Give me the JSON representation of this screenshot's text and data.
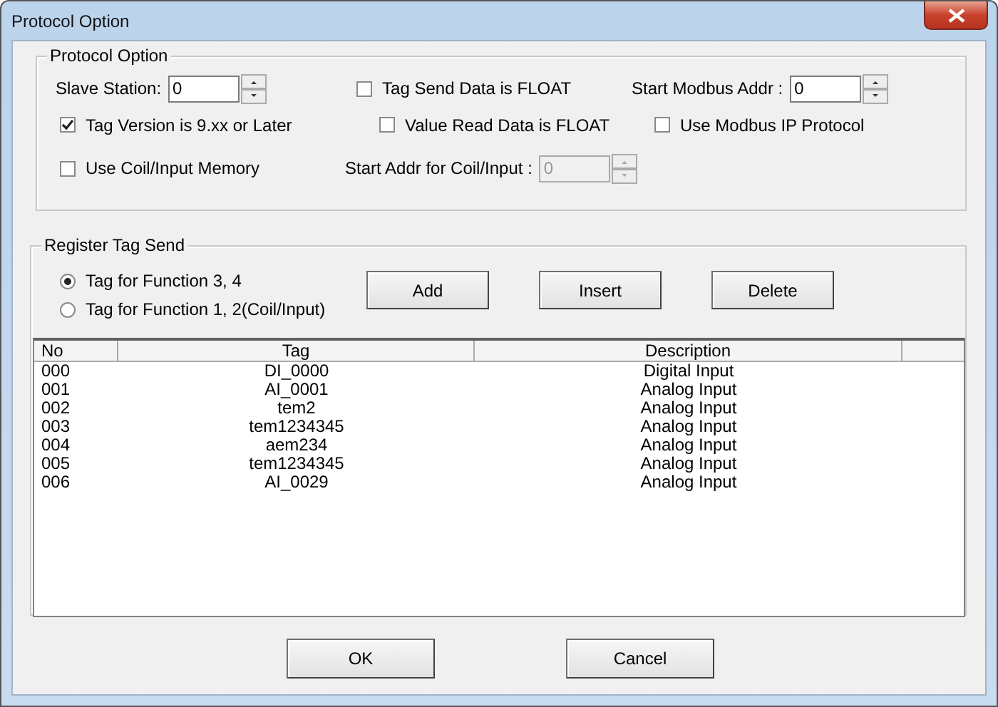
{
  "window": {
    "title": "Protocol Option"
  },
  "protocol_option": {
    "title": "Protocol Option",
    "rows": [
      [
        {
          "kind": "spin",
          "label": "Slave Station:",
          "value": "0",
          "disabled": false
        },
        {
          "kind": "check",
          "label": "Tag Send Data is FLOAT",
          "checked": false
        },
        {
          "kind": "spin",
          "label": "Start Modbus Addr :",
          "value": "0",
          "disabled": false
        }
      ],
      [
        {
          "kind": "check",
          "label": "Tag Version is 9.xx or Later",
          "checked": true
        },
        {
          "kind": "check",
          "label": "Value Read Data is FLOAT",
          "checked": false
        },
        {
          "kind": "check",
          "label": "Use Modbus IP Protocol",
          "checked": false
        }
      ],
      [
        {
          "kind": "check",
          "label": "Use Coil/Input Memory",
          "checked": false
        },
        {
          "kind": "spin",
          "label": "Start Addr for Coil/Input :",
          "value": "0",
          "disabled": true
        }
      ]
    ]
  },
  "register_tag_send": {
    "title": "Register Tag Send",
    "radios": [
      {
        "label": "Tag for Function 3, 4",
        "selected": true
      },
      {
        "label": "Tag for Function 1, 2(Coil/Input)",
        "selected": false
      }
    ],
    "buttons": [
      "Add",
      "Insert",
      "Delete"
    ],
    "table": {
      "columns": [
        "No",
        "Tag",
        "Description"
      ],
      "rows": [
        [
          "000",
          "DI_0000",
          "Digital Input"
        ],
        [
          "001",
          "AI_0001",
          "Analog Input"
        ],
        [
          "002",
          "tem2",
          "Analog Input"
        ],
        [
          "003",
          "tem1234345",
          "Analog Input"
        ],
        [
          "004",
          "aem234",
          "Analog Input"
        ],
        [
          "005",
          "tem1234345",
          "Analog Input"
        ],
        [
          "006",
          "AI_0029",
          "Analog Input"
        ]
      ]
    }
  },
  "buttons": [
    "OK",
    "Cancel"
  ]
}
